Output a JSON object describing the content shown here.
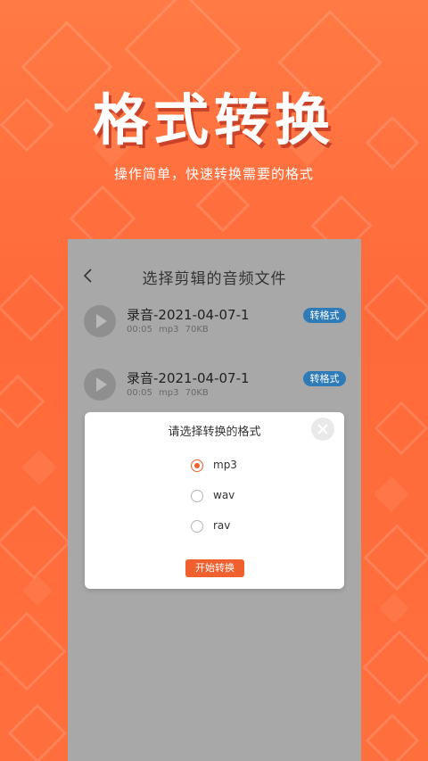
{
  "hero": {
    "title": "格式转换",
    "subtitle": "操作简单，快速转换需要的格式"
  },
  "screen": {
    "title": "选择剪辑的音频文件",
    "files": [
      {
        "name": "录音-2021-04-07-1",
        "meta": "00:05 mp3 70KB",
        "action": "转格式"
      },
      {
        "name": "录音-2021-04-07-1",
        "meta": "00:05 mp3 70KB",
        "action": "转格式"
      }
    ]
  },
  "dialog": {
    "title": "请选择转换的格式",
    "options": [
      {
        "label": "mp3",
        "selected": true
      },
      {
        "label": "wav",
        "selected": false
      },
      {
        "label": "rav",
        "selected": false
      }
    ],
    "start_label": "开始转换"
  },
  "colors": {
    "background": "#ff6a3a",
    "accent": "#f0602f",
    "badge": "#2f7bb8"
  },
  "icons": {
    "back": "chevron-left-icon",
    "play": "play-icon",
    "close": "close-icon"
  }
}
